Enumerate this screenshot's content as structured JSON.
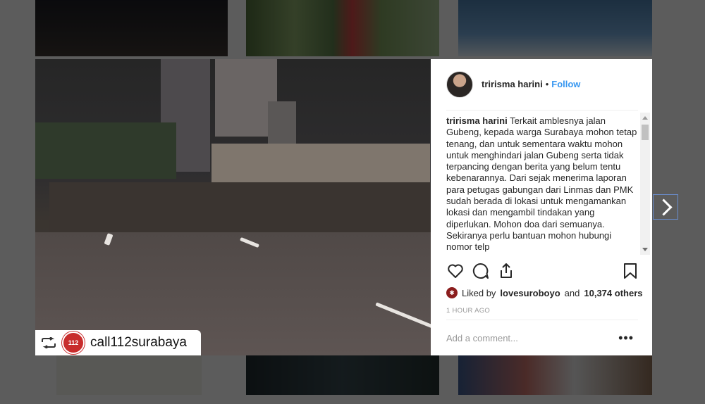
{
  "post": {
    "username": "tririsma harini",
    "follow_label": "Follow",
    "caption_user": "tririsma harini",
    "caption_text": "Terkait amblesnya jalan Gubeng, kepada warga Surabaya mohon tetap tenang, dan untuk sementara waktu mohon untuk menghindari jalan Gubeng serta tidak terpancing dengan berita yang belum tentu kebenarannya. Dari sejak menerima laporan para petugas gabungan dari Linmas dan PMK sudah berada di lokasi untuk mengamankan lokasi dan mengambil tindakan yang diperlukan. Mohon doa dari semuanya. Sekiranya perlu bantuan mohon hubungi nomor telp",
    "liked_prefix": "Liked by",
    "liked_by": "lovesuroboyo",
    "liked_and": "and",
    "liked_others": "10,374 others",
    "timestamp": "1 HOUR AGO",
    "comment_placeholder": "Add a comment...",
    "more_label": "•••"
  },
  "repost": {
    "account": "call112surabaya",
    "badge_text": "112"
  },
  "colors": {
    "accent": "#3897f0",
    "text": "#262626",
    "muted": "#999999"
  }
}
